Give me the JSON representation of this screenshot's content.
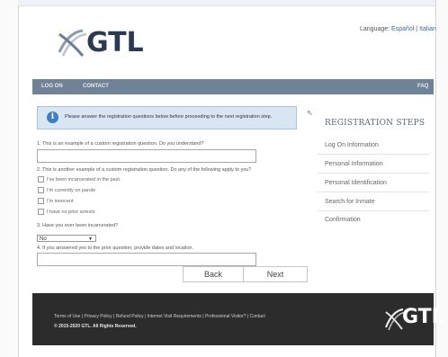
{
  "header": {
    "logo_text": "GTL",
    "language_label": "Language:",
    "language_links": [
      "Español",
      "Italian"
    ]
  },
  "nav": {
    "items": [
      "LOG ON",
      "CONTACT"
    ],
    "faq": "FAQ"
  },
  "notice": {
    "text": "Please answer the registration questions below before proceeding to the next registration step."
  },
  "questions": [
    {
      "label": "1.  This is an example of a custom registration question. Do you understand?"
    },
    {
      "label": "2.  This is another example of a custom registration question. Do any of the following apply to you?",
      "options": [
        "I've been incarcerated in the past.",
        "I'm currently on parole",
        "I'm innocent",
        "I have no prior arrests"
      ]
    },
    {
      "label": "3.  Have you ever been incarcerated?",
      "selected": "No"
    },
    {
      "label": "4.  If you answered yes to the prior question, provide dates and location."
    }
  ],
  "buttons": {
    "back": "Back",
    "next": "Next"
  },
  "steps": {
    "title": "REGISTRATION STEPS",
    "items": [
      "Log On Information",
      "Personal Information",
      "Personal Identification",
      "Search for Inmate",
      "Confirmation"
    ]
  },
  "footer": {
    "links": "Terms of Use | Privacy Policy | Refund Policy | Internet Visit Requirements | Professional Visitor? | Contact",
    "copyright": "© 2015-2020 GTL. All Rights Reserved.",
    "logo_text": "GTL"
  },
  "colors": {
    "nav_bg": "#6f8296",
    "footer_bg": "#2c2c2c",
    "notice_bg": "#d8e6f4",
    "info_icon": "#3d7ec4"
  }
}
